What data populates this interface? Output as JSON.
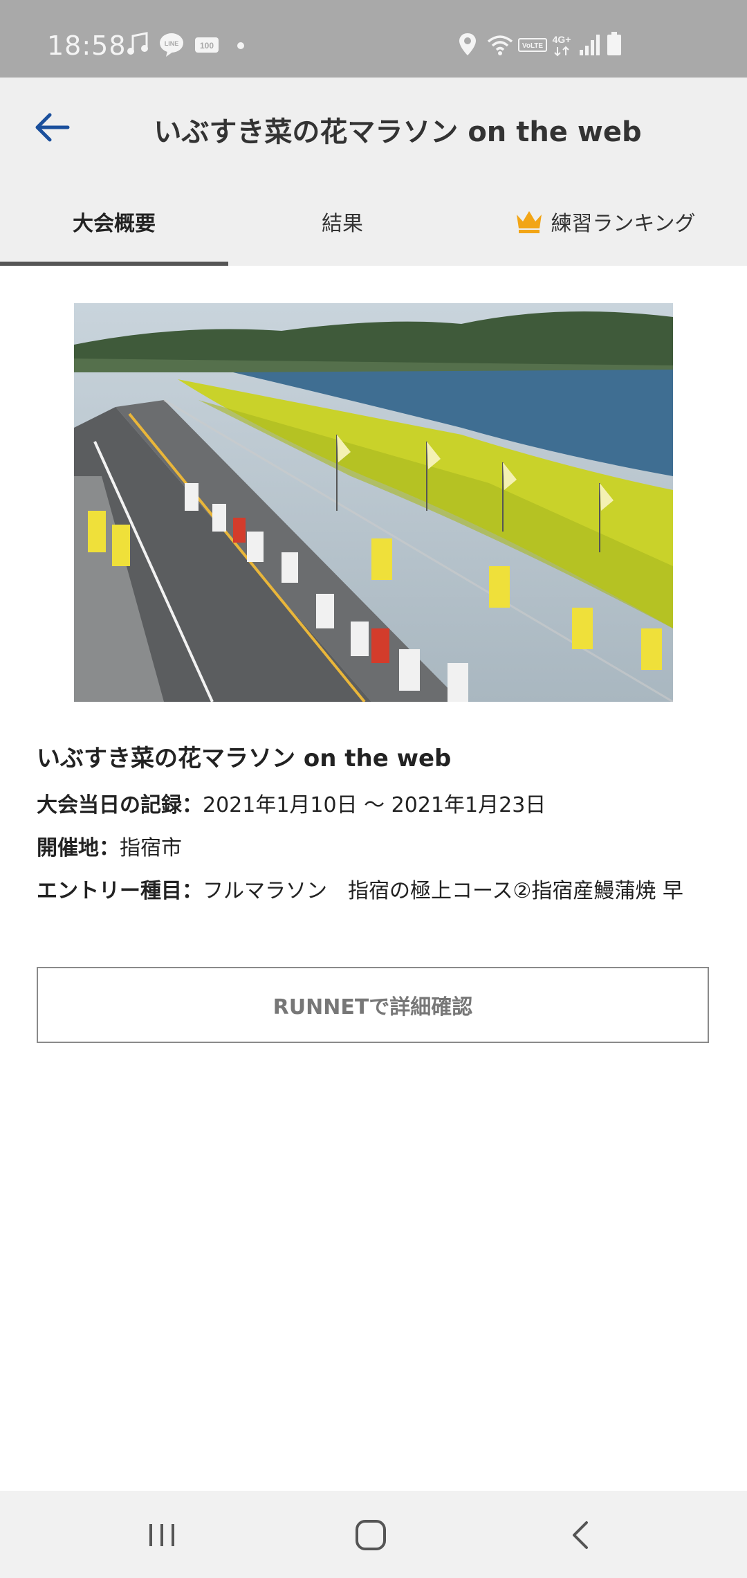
{
  "status": {
    "time": "18:58",
    "icons": [
      "music-icon",
      "line-icon",
      "100-badge-icon",
      "dot-icon",
      "location-icon",
      "wifi-icon",
      "volte-icon",
      "4g-icon",
      "signal-icon",
      "battery-icon"
    ],
    "line_label": "LINE",
    "badge_label": "100",
    "volte_label": "VoLTE",
    "network_label": "4G+"
  },
  "appbar": {
    "title": "いぶすき菜の花マラソン on the web"
  },
  "tabs": [
    {
      "label": "大会概要",
      "active": true
    },
    {
      "label": "結果",
      "active": false
    },
    {
      "label": "練習ランキング",
      "active": false,
      "icon": "crown-icon"
    }
  ],
  "event": {
    "title": "いぶすき菜の花マラソン on the web",
    "date_label": "大会当日の記録：",
    "date_value": "2021年1月10日 〜 2021年1月23日",
    "venue_label": "開催地：",
    "venue_value": "指宿市",
    "entry_label": "エントリー種目：",
    "entry_value": "フルマラソン　指宿の極上コース②指宿産鰻蒲焼 早"
  },
  "runnet_button": "RUNNETで詳細確認",
  "colors": {
    "accent": "#1a4f9c",
    "crown": "#f2a516",
    "statusbar": "#a9a9a9",
    "appbar": "#efefef"
  }
}
